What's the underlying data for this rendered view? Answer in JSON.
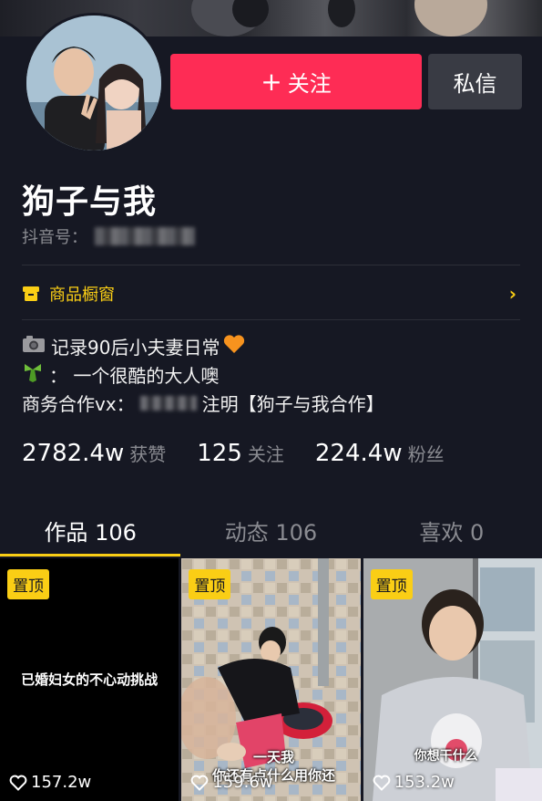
{
  "header": {
    "follow_label": "关注",
    "message_label": "私信"
  },
  "profile": {
    "nickname": "狗子与我",
    "douyin_id_label": "抖音号："
  },
  "shop": {
    "label": "商品橱窗"
  },
  "bio": {
    "line1": "记录90后小夫妻日常",
    "line2": "：  一个很酷的大人噢",
    "line3_prefix": "商务合作vx：",
    "line3_suffix": "注明【狗子与我合作】"
  },
  "stats": {
    "likes_value": "2782.4w",
    "likes_label": "获赞",
    "following_value": "125",
    "following_label": "关注",
    "followers_value": "224.4w",
    "followers_label": "粉丝"
  },
  "tabs": [
    {
      "label": "作品 106"
    },
    {
      "label": "动态 106"
    },
    {
      "label": "喜欢 0"
    }
  ],
  "videos": [
    {
      "pin": "置顶",
      "title": "已婚妇女的不心动挑战",
      "likes": "157.2w"
    },
    {
      "pin": "置顶",
      "subtitle": "一天我\n你还有点什么用你还",
      "likes": "159.6w"
    },
    {
      "pin": "置顶",
      "subtitle": "你想干什么",
      "likes": "153.2w"
    }
  ],
  "colors": {
    "accent_red": "#fe2c55",
    "accent_yellow": "#face15",
    "background": "#161823"
  }
}
